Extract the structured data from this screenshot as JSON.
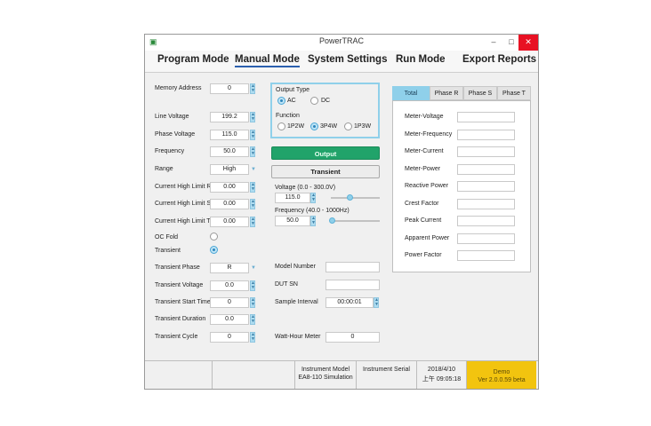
{
  "window": {
    "title": "PowerTRAC",
    "min": "–",
    "max": "□",
    "close": "✕"
  },
  "menu": {
    "program_mode": "Program Mode",
    "manual_mode": "Manual Mode",
    "system_settings": "System Settings",
    "run_mode": "Run Mode",
    "export_reports": "Export Reports"
  },
  "params": {
    "memory_address": {
      "label": "Memory Address",
      "value": "0"
    },
    "line_voltage": {
      "label": "Line Voltage",
      "value": "199.2"
    },
    "phase_voltage": {
      "label": "Phase Voltage",
      "value": "115.0"
    },
    "frequency": {
      "label": "Frequency",
      "value": "50.0"
    },
    "range": {
      "label": "Range",
      "value": "High"
    },
    "chl_r": {
      "label": "Current High Limit R",
      "value": "0.00"
    },
    "chl_s": {
      "label": "Current High Limit S",
      "value": "0.00"
    },
    "chl_t": {
      "label": "Current High Limit T",
      "value": "0.00"
    },
    "oc_fold": {
      "label": "OC Fold"
    },
    "transient": {
      "label": "Transient"
    },
    "transient_phase": {
      "label": "Transient Phase",
      "value": "R"
    },
    "transient_voltage": {
      "label": "Transient Voltage",
      "value": "0.0"
    },
    "transient_start_time": {
      "label": "Transient Start Time",
      "value": "0"
    },
    "transient_duration": {
      "label": "Transient Duration",
      "value": "0.0"
    },
    "transient_cycle": {
      "label": "Transient Cycle",
      "value": "0"
    }
  },
  "output_type": {
    "label": "Output Type",
    "ac": "AC",
    "dc": "DC",
    "selected": "AC"
  },
  "function": {
    "label": "Function",
    "o1": "1P2W",
    "o2": "3P4W",
    "o3": "1P3W",
    "selected": "3P4W"
  },
  "buttons": {
    "output": "Output",
    "transient": "Transient"
  },
  "voltage_slider": {
    "label": "Voltage (0.0 - 300.0V)",
    "value": "115.0",
    "fraction": 0.383
  },
  "frequency_slider": {
    "label": "Frequency (40.0 - 1000Hz)",
    "value": "50.0",
    "fraction": 0.01
  },
  "info": {
    "model_number": {
      "label": "Model Number",
      "value": ""
    },
    "dut_sn": {
      "label": "DUT SN",
      "value": ""
    },
    "sample_interval": {
      "label": "Sample Interval",
      "value": "00:00:01"
    },
    "watt_hour_meter": {
      "label": "Watt-Hour Meter",
      "value": "0"
    }
  },
  "tabs": [
    "Total",
    "Phase R",
    "Phase S",
    "Phase T"
  ],
  "meters": [
    "Meter-Voltage",
    "Meter-Frequency",
    "Meter-Current",
    "Meter-Power",
    "Reactive Power",
    "Crest Factor",
    "Peak Current",
    "Apparent Power",
    "Power Factor"
  ],
  "status": {
    "instrument_model_label": "Instrument Model",
    "instrument_model_value": "EA8-110 Simulation",
    "instrument_serial_label": "Instrument Serial",
    "date": "2018/4/10",
    "time": "上午 09:05:18",
    "demo": "Demo",
    "version": "Ver 2.0.0.59 beta",
    "demo_color": "#f2c40f"
  }
}
